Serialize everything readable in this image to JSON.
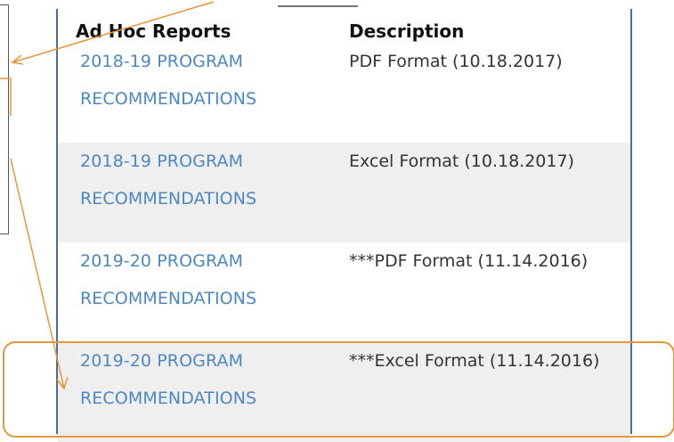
{
  "table": {
    "headers": [
      "Ad Hoc Reports",
      "Description"
    ],
    "rows": [
      {
        "report": "2018-19 PROGRAM RECOMMENDATIONS",
        "description": "PDF Format (10.18.2017)"
      },
      {
        "report": "2018-19 PROGRAM RECOMMENDATIONS",
        "description": "Excel Format (10.18.2017)"
      },
      {
        "report": "2019-20 PROGRAM RECOMMENDATIONS",
        "description": "***PDF Format (11.14.2016)"
      },
      {
        "report": "2019-20 PROGRAM RECOMMENDATIONS",
        "description": "***Excel Format (11.14.2016)"
      }
    ]
  },
  "colors": {
    "link": "#4c88c2",
    "panel_border": "#4a6f98",
    "highlight": "#e8963c",
    "row_alt": "#efefef"
  }
}
